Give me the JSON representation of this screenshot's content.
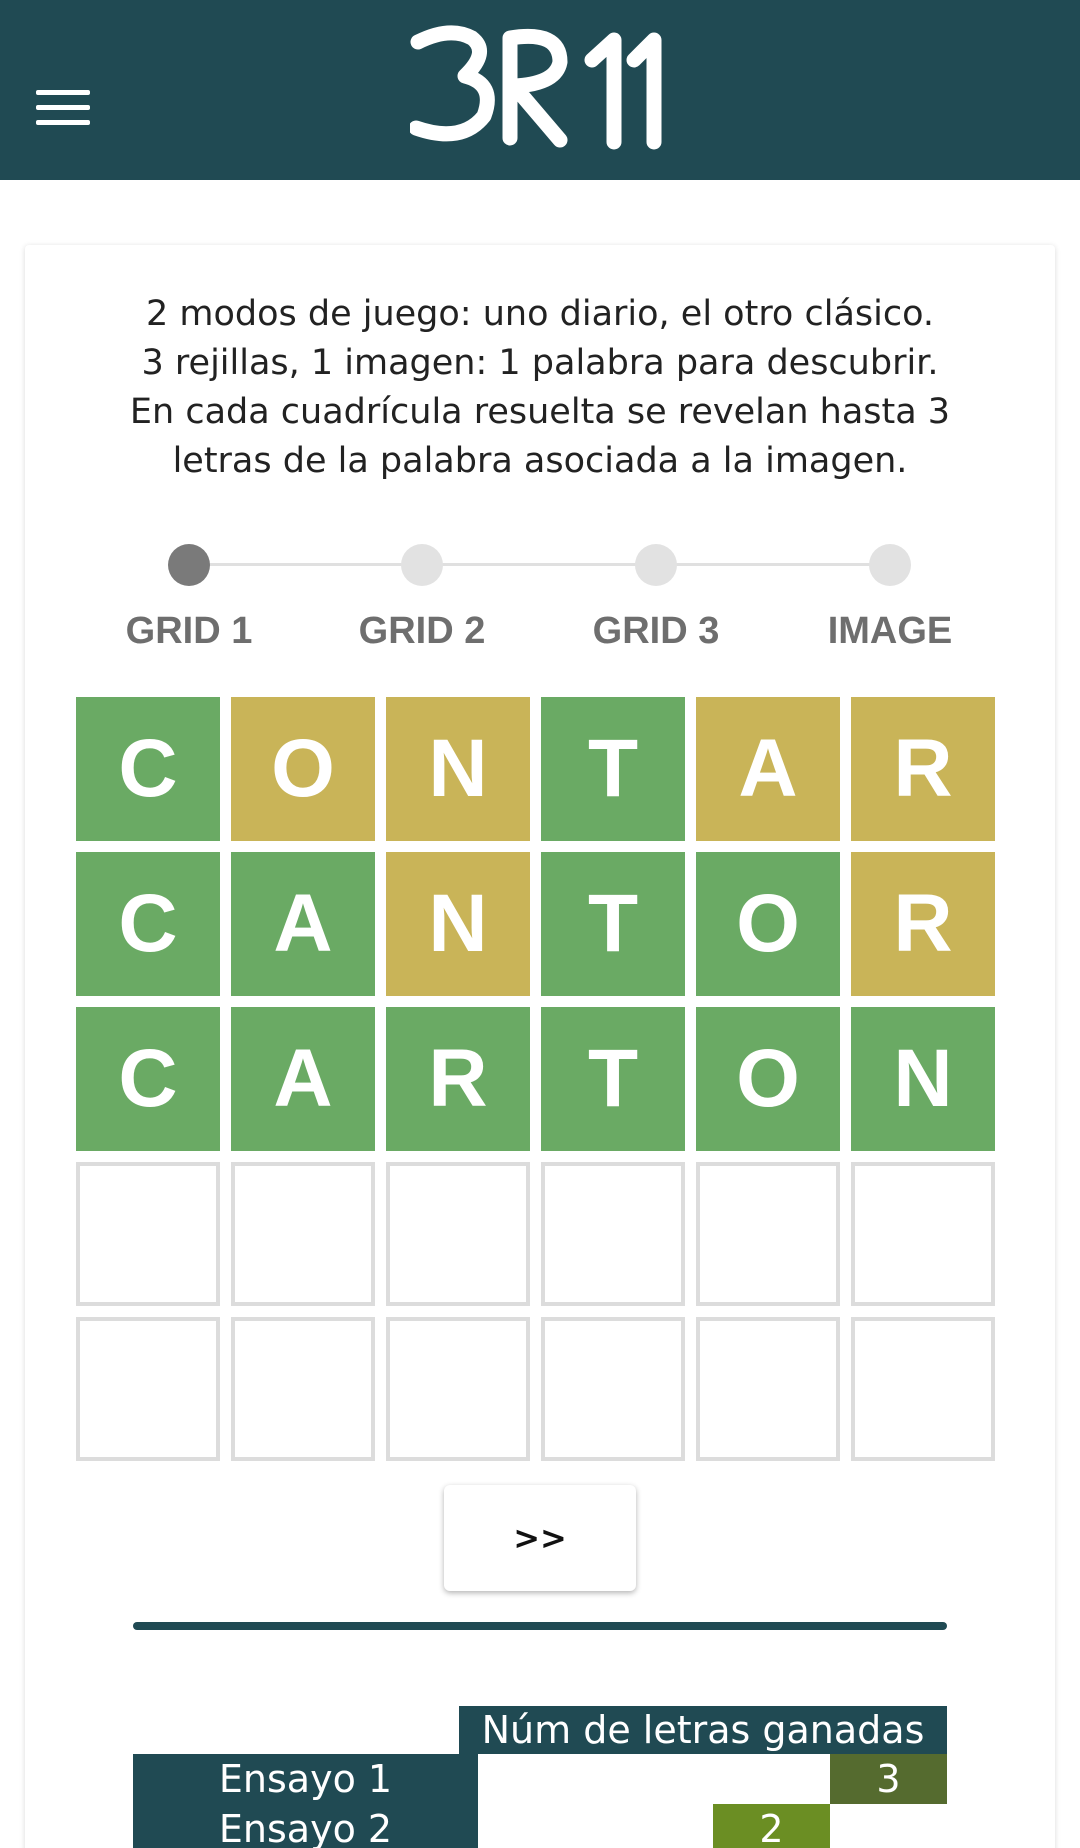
{
  "header": {
    "logo_text": "3R11",
    "background": "#204a53"
  },
  "intro": {
    "lines": [
      "2 modos de juego: uno diario, el otro clásico.",
      "3 rejillas, 1 imagen: 1 palabra para descubrir.",
      "En cada cuadrícula resuelta se revelan hasta 3",
      "letras de la palabra asociada a la imagen."
    ]
  },
  "stepper": {
    "steps": [
      {
        "label": "GRID 1",
        "active": true
      },
      {
        "label": "GRID 2",
        "active": false
      },
      {
        "label": "GRID 3",
        "active": false
      },
      {
        "label": "IMAGE",
        "active": false
      }
    ]
  },
  "grid": {
    "colors": {
      "green": "#6aaa64",
      "yellow": "#c9b458",
      "empty_border": "#dcdcdc"
    },
    "rows": [
      [
        {
          "letter": "C",
          "state": "green"
        },
        {
          "letter": "O",
          "state": "yellow"
        },
        {
          "letter": "N",
          "state": "yellow"
        },
        {
          "letter": "T",
          "state": "green"
        },
        {
          "letter": "A",
          "state": "yellow"
        },
        {
          "letter": "R",
          "state": "yellow"
        }
      ],
      [
        {
          "letter": "C",
          "state": "green"
        },
        {
          "letter": "A",
          "state": "green"
        },
        {
          "letter": "N",
          "state": "yellow"
        },
        {
          "letter": "T",
          "state": "green"
        },
        {
          "letter": "O",
          "state": "green"
        },
        {
          "letter": "R",
          "state": "yellow"
        }
      ],
      [
        {
          "letter": "C",
          "state": "green"
        },
        {
          "letter": "A",
          "state": "green"
        },
        {
          "letter": "R",
          "state": "green"
        },
        {
          "letter": "T",
          "state": "green"
        },
        {
          "letter": "O",
          "state": "green"
        },
        {
          "letter": "N",
          "state": "green"
        }
      ],
      [
        {
          "letter": "",
          "state": "empty"
        },
        {
          "letter": "",
          "state": "empty"
        },
        {
          "letter": "",
          "state": "empty"
        },
        {
          "letter": "",
          "state": "empty"
        },
        {
          "letter": "",
          "state": "empty"
        },
        {
          "letter": "",
          "state": "empty"
        }
      ],
      [
        {
          "letter": "",
          "state": "empty"
        },
        {
          "letter": "",
          "state": "empty"
        },
        {
          "letter": "",
          "state": "empty"
        },
        {
          "letter": "",
          "state": "empty"
        },
        {
          "letter": "",
          "state": "empty"
        },
        {
          "letter": "",
          "state": "empty"
        }
      ]
    ]
  },
  "next_button": {
    "label": ">>"
  },
  "stats": {
    "header": "Núm de letras ganadas",
    "rows": [
      {
        "label": "Ensayo 1",
        "value": "3",
        "color": "#556b2f"
      },
      {
        "label": "Ensayo 2",
        "value": "2",
        "color": "#6b8e23"
      }
    ]
  }
}
